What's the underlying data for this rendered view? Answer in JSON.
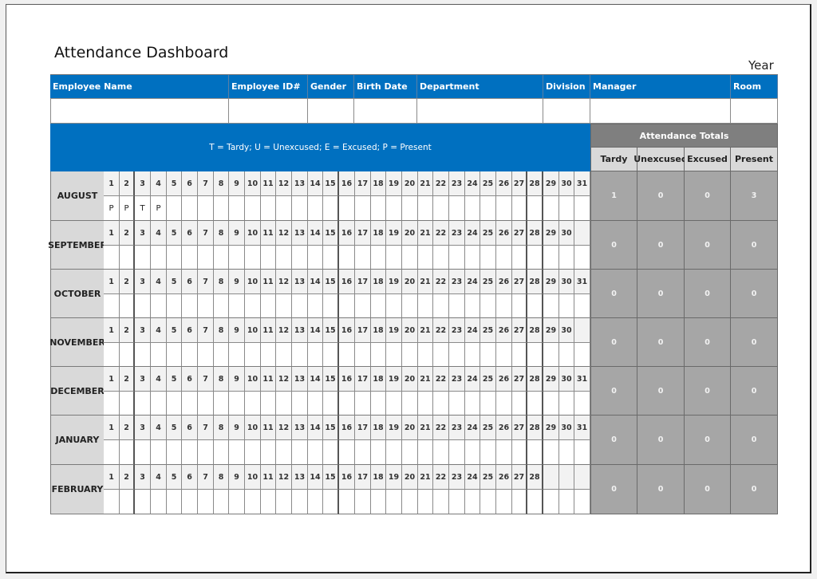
{
  "title": "Attendance Dashboard",
  "year_label": "Year",
  "employee_fields": [
    {
      "key": "employee_name",
      "label": "Employee Name",
      "value": ""
    },
    {
      "key": "employee_id",
      "label": "Employee ID#",
      "value": ""
    },
    {
      "key": "gender",
      "label": "Gender",
      "value": ""
    },
    {
      "key": "birth_date",
      "label": "Birth Date",
      "value": ""
    },
    {
      "key": "department",
      "label": "Department",
      "value": ""
    },
    {
      "key": "division",
      "label": "Division",
      "value": ""
    },
    {
      "key": "manager",
      "label": "Manager",
      "value": ""
    },
    {
      "key": "room",
      "label": "Room",
      "value": ""
    }
  ],
  "legend_text": "T = Tardy; U = Unexcused; E = Excused; P = Present",
  "totals": {
    "title": "Attendance Totals",
    "columns": [
      "Tardy",
      "Unexcused",
      "Excused",
      "Present"
    ]
  },
  "months": [
    {
      "name": "AUGUST",
      "days": 31,
      "marks": {
        "1": "P",
        "2": "P",
        "3": "T",
        "4": "P"
      },
      "totals": [
        "1",
        "0",
        "0",
        "3"
      ]
    },
    {
      "name": "SEPTEMBER",
      "days": 30,
      "marks": {},
      "totals": [
        "0",
        "0",
        "0",
        "0"
      ]
    },
    {
      "name": "OCTOBER",
      "days": 31,
      "marks": {},
      "totals": [
        "0",
        "0",
        "0",
        "0"
      ]
    },
    {
      "name": "NOVEMBER",
      "days": 30,
      "marks": {},
      "totals": [
        "0",
        "0",
        "0",
        "0"
      ]
    },
    {
      "name": "DECEMBER",
      "days": 31,
      "marks": {},
      "totals": [
        "0",
        "0",
        "0",
        "0"
      ]
    },
    {
      "name": "JANUARY",
      "days": 31,
      "marks": {},
      "totals": [
        "0",
        "0",
        "0",
        "0"
      ]
    },
    {
      "name": "FEBRUARY",
      "days": 28,
      "marks": {},
      "totals": [
        "0",
        "0",
        "0",
        "0"
      ]
    }
  ]
}
